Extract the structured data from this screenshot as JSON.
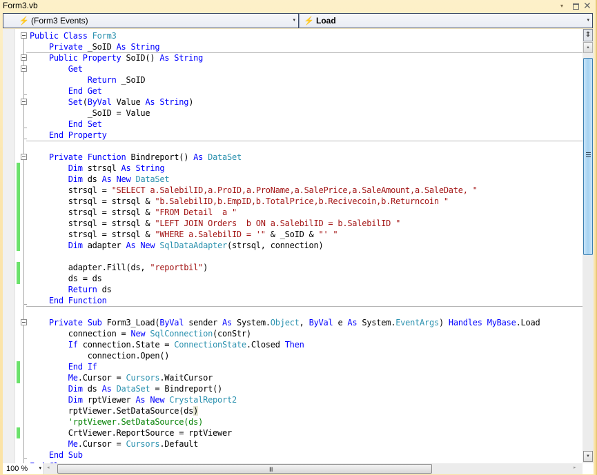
{
  "window": {
    "title": "Form3.vb",
    "controls": {
      "dropdown": "▾",
      "maximize": "",
      "close": "✕"
    }
  },
  "navigation": {
    "object_combo": {
      "icon": "lightning-bolt-icon",
      "value": "(Form3 Events)"
    },
    "member_combo": {
      "icon": "lightning-bolt-icon",
      "value": "Load"
    },
    "arrow": "▾",
    "bolt_glyph": "⚡"
  },
  "code_lines": [
    [
      {
        "t": "Public Class ",
        "c": "kw"
      },
      {
        "t": "Form3",
        "c": "ty"
      }
    ],
    [
      {
        "t": "    "
      },
      {
        "t": "Private ",
        "c": "kw"
      },
      {
        "t": "_SoID "
      },
      {
        "t": "As String",
        "c": "kw"
      }
    ],
    [
      {
        "t": "    "
      },
      {
        "t": "Public Property ",
        "c": "kw"
      },
      {
        "t": "SoID() "
      },
      {
        "t": "As String",
        "c": "kw"
      }
    ],
    [
      {
        "t": "        "
      },
      {
        "t": "Get",
        "c": "kw"
      }
    ],
    [
      {
        "t": "            "
      },
      {
        "t": "Return ",
        "c": "kw"
      },
      {
        "t": "_SoID"
      }
    ],
    [
      {
        "t": "        "
      },
      {
        "t": "End Get",
        "c": "kw"
      }
    ],
    [
      {
        "t": "        "
      },
      {
        "t": "Set",
        "c": "kw"
      },
      {
        "t": "("
      },
      {
        "t": "ByVal ",
        "c": "kw"
      },
      {
        "t": "Value "
      },
      {
        "t": "As String",
        "c": "kw"
      },
      {
        "t": ")"
      }
    ],
    [
      {
        "t": "            _SoID = Value"
      }
    ],
    [
      {
        "t": "        "
      },
      {
        "t": "End Set",
        "c": "kw"
      }
    ],
    [
      {
        "t": "    "
      },
      {
        "t": "End Property",
        "c": "kw"
      }
    ],
    [],
    [
      {
        "t": "    "
      },
      {
        "t": "Private Function ",
        "c": "kw"
      },
      {
        "t": "Bindreport() "
      },
      {
        "t": "As ",
        "c": "kw"
      },
      {
        "t": "DataSet",
        "c": "ty"
      }
    ],
    [
      {
        "t": "        "
      },
      {
        "t": "Dim ",
        "c": "kw"
      },
      {
        "t": "strsql "
      },
      {
        "t": "As String",
        "c": "kw"
      }
    ],
    [
      {
        "t": "        "
      },
      {
        "t": "Dim ",
        "c": "kw"
      },
      {
        "t": "ds "
      },
      {
        "t": "As New ",
        "c": "kw"
      },
      {
        "t": "DataSet",
        "c": "ty"
      }
    ],
    [
      {
        "t": "        strsql = "
      },
      {
        "t": "\"SELECT a.SalebilID,a.ProID,a.ProName,a.SalePrice,a.SaleAmount,a.SaleDate, \"",
        "c": "st"
      }
    ],
    [
      {
        "t": "        strsql = strsql & "
      },
      {
        "t": "\"b.SalebilID,b.EmpID,b.TotalPrice,b.Recivecoin,b.Returncoin \"",
        "c": "st"
      }
    ],
    [
      {
        "t": "        strsql = strsql & "
      },
      {
        "t": "\"FROM Detail  a \"",
        "c": "st"
      }
    ],
    [
      {
        "t": "        strsql = strsql & "
      },
      {
        "t": "\"LEFT JOIN Orders  b ON a.SalebilID = b.SalebilID \"",
        "c": "st"
      }
    ],
    [
      {
        "t": "        strsql = strsql & "
      },
      {
        "t": "\"WHERE a.SalebilID = '\"",
        "c": "st"
      },
      {
        "t": " & _SoID & "
      },
      {
        "t": "\"' \"",
        "c": "st"
      }
    ],
    [
      {
        "t": "        "
      },
      {
        "t": "Dim ",
        "c": "kw"
      },
      {
        "t": "adapter "
      },
      {
        "t": "As New ",
        "c": "kw"
      },
      {
        "t": "SqlDataAdapter",
        "c": "ty"
      },
      {
        "t": "(strsql, connection)"
      }
    ],
    [],
    [
      {
        "t": "        adapter.Fill(ds, "
      },
      {
        "t": "\"reportbil\"",
        "c": "st"
      },
      {
        "t": ")"
      }
    ],
    [
      {
        "t": "        ds = ds"
      }
    ],
    [
      {
        "t": "        "
      },
      {
        "t": "Return ",
        "c": "kw"
      },
      {
        "t": "ds"
      }
    ],
    [
      {
        "t": "    "
      },
      {
        "t": "End Function",
        "c": "kw"
      }
    ],
    [],
    [
      {
        "t": "    "
      },
      {
        "t": "Private Sub ",
        "c": "kw"
      },
      {
        "t": "Form3_Load("
      },
      {
        "t": "ByVal ",
        "c": "kw"
      },
      {
        "t": "sender "
      },
      {
        "t": "As ",
        "c": "kw"
      },
      {
        "t": "System."
      },
      {
        "t": "Object",
        "c": "ty"
      },
      {
        "t": ", "
      },
      {
        "t": "ByVal ",
        "c": "kw"
      },
      {
        "t": "e "
      },
      {
        "t": "As ",
        "c": "kw"
      },
      {
        "t": "System."
      },
      {
        "t": "EventArgs",
        "c": "ty"
      },
      {
        "t": ") "
      },
      {
        "t": "Handles ",
        "c": "kw"
      },
      {
        "t": "MyBase",
        "c": "kw"
      },
      {
        "t": ".Load"
      }
    ],
    [
      {
        "t": "        connection = "
      },
      {
        "t": "New ",
        "c": "kw"
      },
      {
        "t": "SqlConnection",
        "c": "ty"
      },
      {
        "t": "(conStr)"
      }
    ],
    [
      {
        "t": "        "
      },
      {
        "t": "If ",
        "c": "kw"
      },
      {
        "t": "connection.State = "
      },
      {
        "t": "ConnectionState",
        "c": "ty"
      },
      {
        "t": ".Closed "
      },
      {
        "t": "Then",
        "c": "kw"
      }
    ],
    [
      {
        "t": "            connection.Open()"
      }
    ],
    [
      {
        "t": "        "
      },
      {
        "t": "End If",
        "c": "kw"
      }
    ],
    [
      {
        "t": "        "
      },
      {
        "t": "Me",
        "c": "kw"
      },
      {
        "t": ".Cursor = "
      },
      {
        "t": "Cursors",
        "c": "ty"
      },
      {
        "t": ".WaitCursor"
      }
    ],
    [
      {
        "t": "        "
      },
      {
        "t": "Dim ",
        "c": "kw"
      },
      {
        "t": "ds "
      },
      {
        "t": "As ",
        "c": "kw"
      },
      {
        "t": "DataSet",
        "c": "ty"
      },
      {
        "t": " = Bindreport()"
      }
    ],
    [
      {
        "t": "        "
      },
      {
        "t": "Dim ",
        "c": "kw"
      },
      {
        "t": "rptViewer "
      },
      {
        "t": "As New ",
        "c": "kw"
      },
      {
        "t": "CrystalReport2",
        "c": "ty"
      }
    ],
    [
      {
        "t": "        rptViewer.SetDataSource(ds"
      },
      {
        "t": ")",
        "c": "hl"
      }
    ],
    [
      {
        "t": "        "
      },
      {
        "t": "'rptViewer.SetDataSource(ds)",
        "c": "cm"
      }
    ],
    [
      {
        "t": "        CrtViewer.ReportSource = rptViewer"
      }
    ],
    [
      {
        "t": "        "
      },
      {
        "t": "Me",
        "c": "kw"
      },
      {
        "t": ".Cursor = "
      },
      {
        "t": "Cursors",
        "c": "ty"
      },
      {
        "t": ".Default"
      }
    ],
    [
      {
        "t": "    "
      },
      {
        "t": "End Sub",
        "c": "kw"
      }
    ],
    [
      {
        "t": "End Cl",
        "c": "kw"
      }
    ]
  ],
  "changed_lines": [
    12,
    13,
    14,
    15,
    16,
    17,
    18,
    19,
    21,
    22,
    30,
    31,
    36
  ],
  "fold_lines": [
    0,
    2,
    3,
    6,
    11,
    26
  ],
  "separator_after_lines": [
    1,
    9,
    24
  ],
  "bottom": {
    "zoom_level": "100 %",
    "arrow": "▾",
    "hscroll_left": "◂",
    "hscroll_right": "▸",
    "hscroll_grip": "III"
  },
  "vscroll": {
    "up": "▲",
    "down": "▼",
    "split": "⇕"
  }
}
